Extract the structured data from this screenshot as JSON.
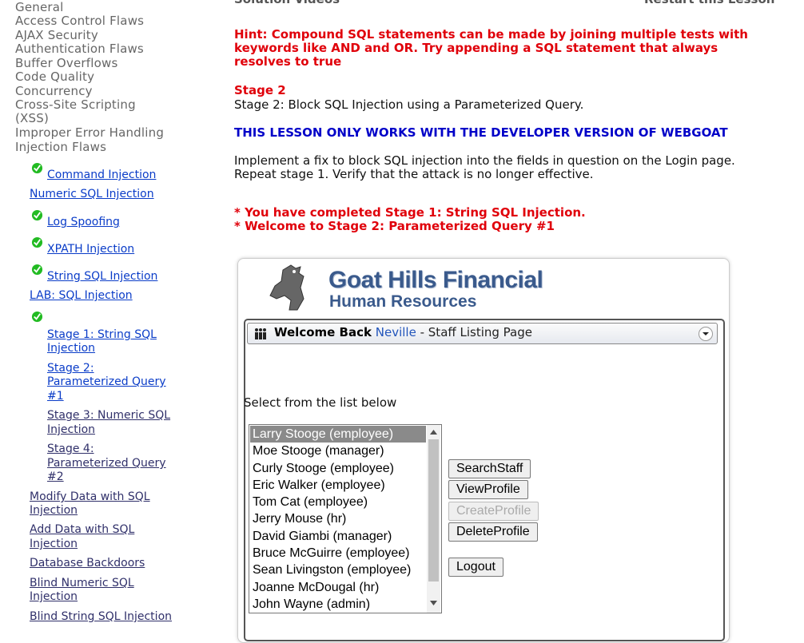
{
  "top": {
    "solution_videos": "Solution Videos",
    "restart": "Restart this Lesson"
  },
  "sidebar": {
    "categories": [
      "General",
      "Access Control Flaws",
      "AJAX Security",
      "Authentication Flaws",
      "Buffer Overflows",
      "Code Quality",
      "Concurrency",
      "Cross-Site Scripting",
      "(XSS)",
      "Improper Error Handling",
      "Injection Flaws"
    ],
    "lessons": {
      "command": "Command Injection",
      "numeric": "Numeric SQL Injection",
      "log": "Log Spoofing",
      "xpath": "XPATH Injection",
      "string": "String SQL Injection",
      "lab": "LAB: SQL Injection",
      "stage1_a": "Stage 1: String SQL",
      "stage1_b": "Injection",
      "stage2_a": "Stage 2:",
      "stage2_b": "Parameterized Query",
      "stage2_c": "#1",
      "stage3_a": "Stage 3: Numeric SQL",
      "stage3_b": "Injection",
      "stage4_a": "Stage 4:",
      "stage4_b": "Parameterized Query",
      "stage4_c": "#2",
      "modify_a": "Modify Data with SQL",
      "modify_b": "Injection",
      "add_a": "Add Data with SQL",
      "add_b": "Injection",
      "backdoors": "Database Backdoors",
      "blindnum_a": "Blind Numeric SQL",
      "blindnum_b": "Injection",
      "blindstr": "Blind String SQL Injection"
    }
  },
  "main": {
    "hint1": "Hint: Compound SQL statements can be made by joining multiple tests with",
    "hint2": "keywords like AND and OR. Try appending a SQL statement that always",
    "hint3": "resolves to true",
    "stage_title": "Stage 2",
    "stage_desc": "Stage 2: Block SQL Injection using a Parameterized Query.",
    "dev_warning": "THIS LESSON ONLY WORKS WITH THE DEVELOPER VERSION OF WEBGOAT",
    "instr1": "Implement a fix to block SQL injection into the fields in question on the Login page.",
    "instr2": "Repeat stage 1. Verify that the attack is no longer effective.",
    "msg1": "* You have completed Stage 1: String SQL Injection.",
    "msg2": "* Welcome to Stage 2: Parameterized Query #1"
  },
  "app": {
    "logo_line1": "Goat Hills Financial",
    "logo_line2": "Human Resources",
    "welcome": "Welcome Back",
    "user": "Neville",
    "page": "- Staff Listing Page",
    "select_label": "Select from the list below",
    "staff": [
      "Larry Stooge (employee)",
      "Moe Stooge (manager)",
      "Curly Stooge (employee)",
      "Eric Walker (employee)",
      "Tom Cat (employee)",
      "Jerry Mouse (hr)",
      "David Giambi (manager)",
      "Bruce McGuirre (employee)",
      "Sean Livingston (employee)",
      "Joanne McDougal (hr)",
      "John Wayne (admin)"
    ],
    "buttons": {
      "search": "SearchStaff",
      "view": "ViewProfile",
      "create": "CreateProfile",
      "delete": "DeleteProfile",
      "logout": "Logout"
    }
  },
  "colors": {
    "hint_red": "#e0000a",
    "warning_blue": "#0000c8",
    "link_blue": "#0a3cc8",
    "check_green": "#22bb22",
    "logo_blue": "#3a5a8c"
  }
}
